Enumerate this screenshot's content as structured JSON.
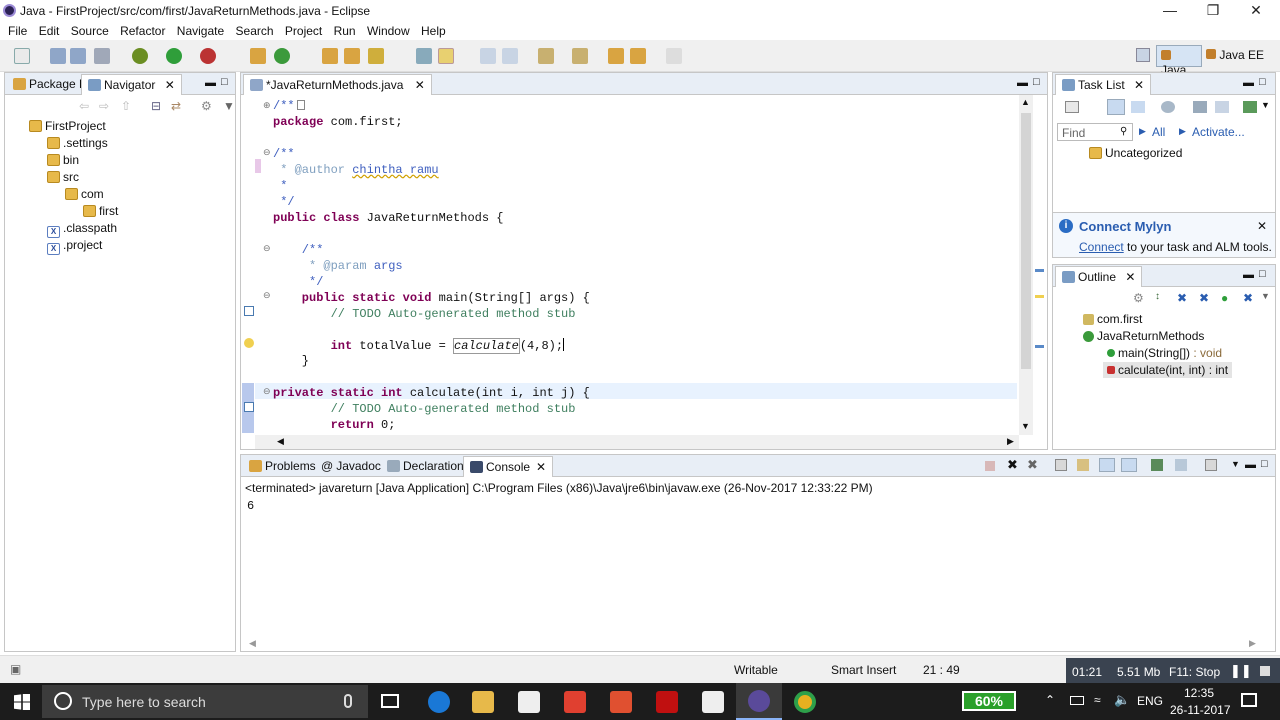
{
  "window": {
    "title": "Java - FirstProject/src/com/first/JavaReturnMethods.java - Eclipse"
  },
  "menu": [
    "File",
    "Edit",
    "Source",
    "Refactor",
    "Navigate",
    "Search",
    "Project",
    "Run",
    "Window",
    "Help"
  ],
  "perspectives": {
    "java": "Java",
    "javaee": "Java EE"
  },
  "left_panel": {
    "tabs": [
      "Package E",
      "Navigator"
    ],
    "tree": [
      "FirstProject",
      ".settings",
      "bin",
      "src",
      "com",
      "first",
      ".classpath",
      ".project"
    ]
  },
  "editor": {
    "tab": "*JavaReturnMethods.java",
    "lines": {
      "l1": "/**",
      "l2_kw": "package",
      "l2_rest": " com.first;",
      "l3": "/**",
      "l4_a": " * @author ",
      "l4_b": "chintha ramu",
      "l5": " *",
      "l6": " */",
      "l7_kw": "public class",
      "l7_rest": " JavaReturnMethods {",
      "l8": "    /**",
      "l9_a": "     * @param ",
      "l9_b": "args",
      "l10": "     */",
      "l11_kw": "    public static void",
      "l11_rest": " main(String[] args) {",
      "l12": "        // TODO Auto-generated method stub",
      "l13_kw": "        int",
      "l13_rest": " totalValue = ",
      "l13_call": "calculate",
      "l13_end": "(4,8);",
      "l14": "    }",
      "l15_kw": "private static int",
      "l15_name": " calculate",
      "l15_p1": "(int i, int j) {",
      "l16": "        // TODO Auto-generated method stub",
      "l17_kw": "        return",
      "l17_rest": " 0;"
    }
  },
  "task_list": {
    "tab": "Task List",
    "find_placeholder": "Find",
    "all": "All",
    "activate": "Activate...",
    "category": "Uncategorized"
  },
  "mylyn": {
    "title": "Connect Mylyn",
    "link": "Connect",
    "rest": " to your task and ALM tools."
  },
  "outline": {
    "tab": "Outline",
    "package": "com.first",
    "class": "JavaReturnMethods",
    "m1": "main(String[])",
    "m1_type": " : void",
    "m2": "calculate(int, int) : int"
  },
  "bottom": {
    "tabs": [
      "Problems",
      "Javadoc",
      "Declaration",
      "Console"
    ],
    "header": "<terminated> javareturn [Java Application] C:\\Program Files (x86)\\Java\\jre6\\bin\\javaw.exe (26-Nov-2017 12:33:22 PM)",
    "output": "6"
  },
  "status": {
    "writable": "Writable",
    "insert": "Smart Insert",
    "position": "21 : 49"
  },
  "recorder": {
    "time": "01:21",
    "size": "5.51 Mb",
    "hotkey": "F11: Stop"
  },
  "taskbar": {
    "search": "Type here to search",
    "battery": "60%",
    "lang": "ENG",
    "time": "12:35",
    "date": "26-11-2017"
  }
}
